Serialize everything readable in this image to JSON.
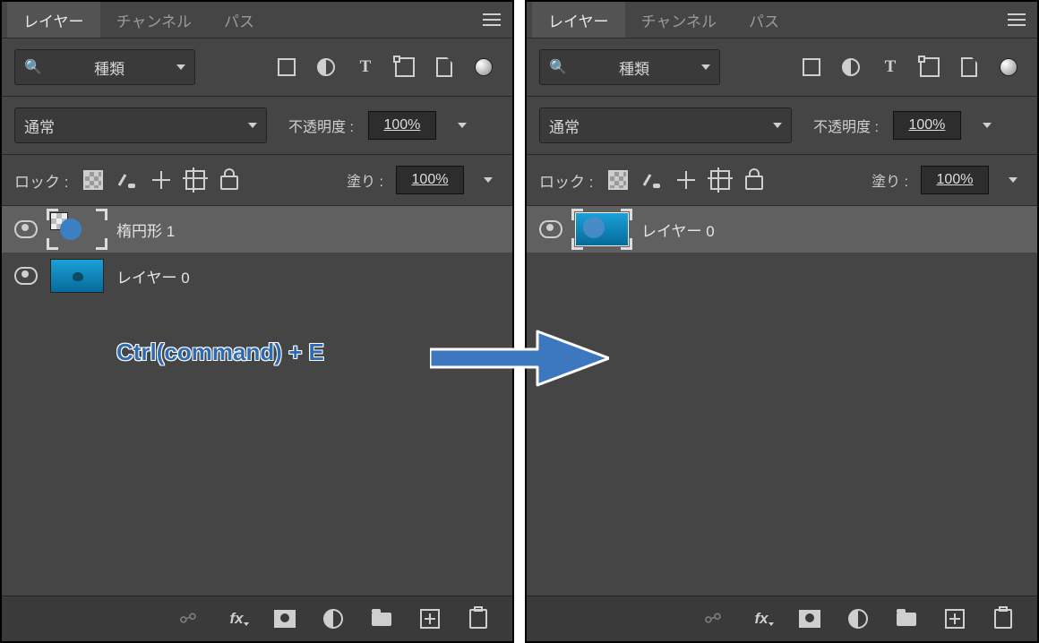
{
  "tabs": {
    "layers": "レイヤー",
    "channels": "チャンネル",
    "paths": "パス"
  },
  "filter_label": "種類",
  "blend_mode": "通常",
  "opacity_label": "不透明度 :",
  "opacity_value": "100%",
  "lock_label": "ロック :",
  "fill_label": "塗り :",
  "fill_value": "100%",
  "layers_left": [
    {
      "name": "楕円形 1",
      "selected": true,
      "thumb": "shape"
    },
    {
      "name": "レイヤー 0",
      "selected": false,
      "thumb": "photo"
    }
  ],
  "layers_right": [
    {
      "name": "レイヤー 0",
      "selected": true,
      "thumb": "merged"
    }
  ],
  "annotation": "Ctrl(command) + E"
}
